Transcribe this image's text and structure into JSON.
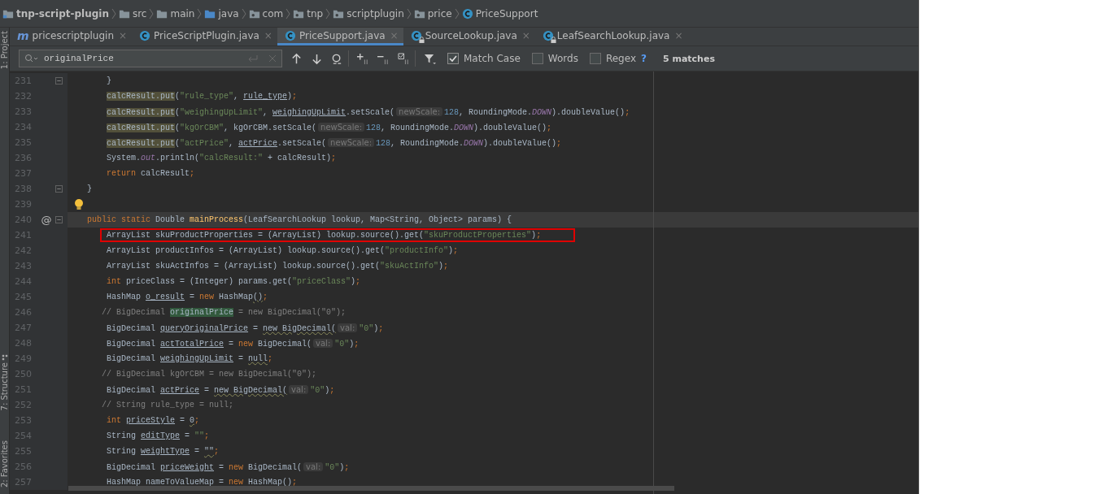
{
  "breadcrumb": [
    {
      "label": "tnp-script-plugin",
      "kind": "module",
      "bold": true
    },
    {
      "label": "src",
      "kind": "folder",
      "bold": false
    },
    {
      "label": "main",
      "kind": "folder",
      "bold": false
    },
    {
      "label": "java",
      "kind": "source",
      "bold": false
    },
    {
      "label": "com",
      "kind": "package",
      "bold": false
    },
    {
      "label": "tnp",
      "kind": "package",
      "bold": false
    },
    {
      "label": "scriptplugin",
      "kind": "package",
      "bold": false
    },
    {
      "label": "price",
      "kind": "package",
      "bold": false
    },
    {
      "label": "PriceSupport",
      "kind": "class",
      "bold": false
    }
  ],
  "side_tools": [
    "1: Project",
    "7: Structure",
    "2: Favorites"
  ],
  "tabs": [
    {
      "label": "pricescriptplugin",
      "kind": "module",
      "icon_text": "m",
      "locked": false,
      "selected": false,
      "close": "×"
    },
    {
      "label": "PriceScriptPlugin.java",
      "kind": "class",
      "locked": false,
      "selected": false,
      "close": "×"
    },
    {
      "label": "PriceSupport.java",
      "kind": "class",
      "locked": false,
      "selected": true,
      "close": "×"
    },
    {
      "label": "SourceLookup.java",
      "kind": "class",
      "locked": true,
      "selected": false,
      "close": "×"
    },
    {
      "label": "LeafSearchLookup.java",
      "kind": "class",
      "locked": true,
      "selected": false,
      "close": "×"
    }
  ],
  "search": {
    "value": "originalPrice",
    "options": [
      {
        "label": "Match Case",
        "checked": true
      },
      {
        "label": "Words",
        "checked": false
      },
      {
        "label": "Regex",
        "checked": false
      }
    ],
    "help": "?",
    "matches": "5 matches"
  },
  "lines": [
    {
      "n": "231",
      "kind": "stmt",
      "fold": true,
      "bulb": false,
      "current": false,
      "boxed": false,
      "tokens": [
        {
          "kind": "p",
          "t": "}"
        }
      ]
    },
    {
      "n": "232",
      "kind": "stmt",
      "fold": false,
      "bulb": false,
      "current": false,
      "boxed": false,
      "tokens": [
        {
          "kind": "usage",
          "t": "calcResult.put"
        },
        {
          "kind": "p",
          "t": "("
        },
        {
          "kind": "str",
          "t": "\"rule_type\""
        },
        {
          "kind": "p",
          "t": ", "
        },
        {
          "kind": "u",
          "t": "rule_type"
        },
        {
          "kind": "p",
          "t": ")"
        },
        {
          "kind": "kw",
          "t": ";"
        }
      ]
    },
    {
      "n": "233",
      "kind": "stmt",
      "fold": false,
      "bulb": false,
      "current": false,
      "boxed": false,
      "tokens": [
        {
          "kind": "usage",
          "t": "calcResult.put"
        },
        {
          "kind": "p",
          "t": "("
        },
        {
          "kind": "str",
          "t": "\"weighingUpLimit\""
        },
        {
          "kind": "p",
          "t": ", "
        },
        {
          "kind": "u",
          "t": "weighingUpLimit"
        },
        {
          "kind": "p",
          "t": ".setScale("
        },
        {
          "kind": "hint",
          "t": "newScale:"
        },
        {
          "kind": "num",
          "t": "128"
        },
        {
          "kind": "p",
          "t": ", RoundingMode."
        },
        {
          "kind": "st",
          "t": "DOWN"
        },
        {
          "kind": "p",
          "t": ").doubleValue()"
        },
        {
          "kind": "kw",
          "t": ";"
        }
      ]
    },
    {
      "n": "234",
      "kind": "stmt",
      "fold": false,
      "bulb": false,
      "current": false,
      "boxed": false,
      "tokens": [
        {
          "kind": "usage",
          "t": "calcResult.put"
        },
        {
          "kind": "p",
          "t": "("
        },
        {
          "kind": "str",
          "t": "\"kgOrCBM\""
        },
        {
          "kind": "p",
          "t": ", kgOrCBM.setScale("
        },
        {
          "kind": "hint",
          "t": "newScale:"
        },
        {
          "kind": "num",
          "t": "128"
        },
        {
          "kind": "p",
          "t": ", RoundingMode."
        },
        {
          "kind": "st",
          "t": "DOWN"
        },
        {
          "kind": "p",
          "t": ").doubleValue()"
        },
        {
          "kind": "kw",
          "t": ";"
        }
      ]
    },
    {
      "n": "235",
      "kind": "stmt",
      "fold": false,
      "bulb": false,
      "current": false,
      "boxed": false,
      "tokens": [
        {
          "kind": "usage",
          "t": "calcResult.put"
        },
        {
          "kind": "p",
          "t": "("
        },
        {
          "kind": "str",
          "t": "\"actPrice\""
        },
        {
          "kind": "p",
          "t": ", "
        },
        {
          "kind": "u",
          "t": "actPrice"
        },
        {
          "kind": "p",
          "t": ".setScale("
        },
        {
          "kind": "hint",
          "t": "newScale:"
        },
        {
          "kind": "num",
          "t": "128"
        },
        {
          "kind": "p",
          "t": ", RoundingMode."
        },
        {
          "kind": "st",
          "t": "DOWN"
        },
        {
          "kind": "p",
          "t": ").doubleValue()"
        },
        {
          "kind": "kw",
          "t": ";"
        }
      ]
    },
    {
      "n": "236",
      "kind": "stmt",
      "fold": false,
      "bulb": false,
      "current": false,
      "boxed": false,
      "tokens": [
        {
          "kind": "p",
          "t": "System."
        },
        {
          "kind": "st",
          "t": "out"
        },
        {
          "kind": "p",
          "t": ".println("
        },
        {
          "kind": "str",
          "t": "\"calcResult:\""
        },
        {
          "kind": "p",
          "t": " + calcResult)"
        },
        {
          "kind": "kw",
          "t": ";"
        }
      ]
    },
    {
      "n": "237",
      "kind": "stmt",
      "fold": false,
      "bulb": false,
      "current": false,
      "boxed": false,
      "tokens": [
        {
          "kind": "kw",
          "t": "return"
        },
        {
          "kind": "p",
          "t": " calcResult"
        },
        {
          "kind": "kw",
          "t": ";"
        }
      ]
    },
    {
      "n": "238",
      "kind": "member",
      "fold": true,
      "bulb": false,
      "current": false,
      "boxed": false,
      "tokens": [
        {
          "kind": "p",
          "t": "}"
        }
      ]
    },
    {
      "n": "239",
      "kind": "blank",
      "fold": false,
      "bulb": true,
      "current": false,
      "boxed": false
    },
    {
      "n": "240",
      "kind": "member",
      "fold": true,
      "bulb": false,
      "mark": "@",
      "current": true,
      "boxed": false,
      "tokens": [
        {
          "kind": "kw",
          "t": "public static"
        },
        {
          "kind": "p",
          "t": " Double "
        },
        {
          "kind": "decl",
          "t": "mainProcess"
        },
        {
          "kind": "p",
          "t": "(LeafSearchLookup lookup, Map<String, Object> params) {"
        }
      ]
    },
    {
      "n": "241",
      "kind": "stmt",
      "fold": false,
      "bulb": false,
      "current": false,
      "boxed": true,
      "tokens": [
        {
          "kind": "p",
          "t": "ArrayList skuProductProperties = (ArrayList) lookup.source().get("
        },
        {
          "kind": "str",
          "t": "\"skuProductProperties\""
        },
        {
          "kind": "p",
          "t": ")"
        },
        {
          "kind": "kw",
          "t": ";"
        }
      ]
    },
    {
      "n": "242",
      "kind": "stmt",
      "fold": false,
      "bulb": false,
      "current": false,
      "boxed": false,
      "tokens": [
        {
          "kind": "p",
          "t": "ArrayList productInfos = (ArrayList) lookup.source().get("
        },
        {
          "kind": "str",
          "t": "\"productInfo\""
        },
        {
          "kind": "p",
          "t": ")"
        },
        {
          "kind": "kw",
          "t": ";"
        }
      ]
    },
    {
      "n": "243",
      "kind": "stmt",
      "fold": false,
      "bulb": false,
      "current": false,
      "boxed": false,
      "tokens": [
        {
          "kind": "p",
          "t": "ArrayList skuActInfos = (ArrayList) lookup.source().get("
        },
        {
          "kind": "str",
          "t": "\"skuActInfo\""
        },
        {
          "kind": "p",
          "t": ")"
        },
        {
          "kind": "kw",
          "t": ";"
        }
      ]
    },
    {
      "n": "244",
      "kind": "stmt",
      "fold": false,
      "bulb": false,
      "current": false,
      "boxed": false,
      "tokens": [
        {
          "kind": "kw",
          "t": "int"
        },
        {
          "kind": "p",
          "t": " priceClass = (Integer) params.get("
        },
        {
          "kind": "str",
          "t": "\"priceClass\""
        },
        {
          "kind": "p",
          "t": ")"
        },
        {
          "kind": "kw",
          "t": ";"
        }
      ]
    },
    {
      "n": "245",
      "kind": "stmt",
      "fold": false,
      "bulb": false,
      "current": false,
      "boxed": false,
      "tokens": [
        {
          "kind": "p",
          "t": "HashMap "
        },
        {
          "kind": "u",
          "t": "o_result"
        },
        {
          "kind": "p",
          "t": " = "
        },
        {
          "kind": "kw",
          "t": "new"
        },
        {
          "kind": "p",
          "t": " HashMap"
        },
        {
          "kind": "w",
          "t": "()"
        },
        {
          "kind": "kw",
          "t": ";"
        }
      ]
    },
    {
      "n": "246",
      "kind": "commented",
      "fold": false,
      "bulb": false,
      "current": false,
      "boxed": false,
      "tokens": [
        {
          "kind": "cm",
          "t": "// BigDecimal "
        },
        {
          "kind": "match",
          "t": "originalPrice"
        },
        {
          "kind": "cm",
          "t": " = new BigDecimal(\"0\");"
        }
      ]
    },
    {
      "n": "247",
      "kind": "stmt",
      "fold": false,
      "bulb": false,
      "current": false,
      "boxed": false,
      "tokens": [
        {
          "kind": "p",
          "t": "BigDecimal "
        },
        {
          "kind": "u",
          "t": "queryOriginalPrice"
        },
        {
          "kind": "p",
          "t": " = "
        },
        {
          "kind": "w",
          "t": "new BigDecimal("
        },
        {
          "kind": "hint",
          "t": "val:"
        },
        {
          "kind": "str",
          "t": "\"0\""
        },
        {
          "kind": "p",
          "t": ")"
        },
        {
          "kind": "kw",
          "t": ";"
        }
      ]
    },
    {
      "n": "248",
      "kind": "stmt",
      "fold": false,
      "bulb": false,
      "current": false,
      "boxed": false,
      "tokens": [
        {
          "kind": "p",
          "t": "BigDecimal "
        },
        {
          "kind": "u",
          "t": "actTotalPrice"
        },
        {
          "kind": "p",
          "t": " = "
        },
        {
          "kind": "kw",
          "t": "new"
        },
        {
          "kind": "p",
          "t": " BigDecimal("
        },
        {
          "kind": "hint",
          "t": "val:"
        },
        {
          "kind": "str",
          "t": "\"0\""
        },
        {
          "kind": "p",
          "t": ")"
        },
        {
          "kind": "kw",
          "t": ";"
        }
      ]
    },
    {
      "n": "249",
      "kind": "stmt",
      "fold": false,
      "bulb": false,
      "current": false,
      "boxed": false,
      "tokens": [
        {
          "kind": "p",
          "t": "BigDecimal "
        },
        {
          "kind": "u",
          "t": "weighingUpLimit"
        },
        {
          "kind": "p",
          "t": " = "
        },
        {
          "kind": "w",
          "t": "null"
        },
        {
          "kind": "kw",
          "t": ";"
        }
      ]
    },
    {
      "n": "250",
      "kind": "commented",
      "fold": false,
      "bulb": false,
      "current": false,
      "boxed": false,
      "tokens": [
        {
          "kind": "cm",
          "t": "// BigDecimal kgOrCBM = new BigDecimal(\"0\");"
        }
      ]
    },
    {
      "n": "251",
      "kind": "stmt",
      "fold": false,
      "bulb": false,
      "current": false,
      "boxed": false,
      "tokens": [
        {
          "kind": "p",
          "t": "BigDecimal "
        },
        {
          "kind": "u",
          "t": "actPrice"
        },
        {
          "kind": "p",
          "t": " = "
        },
        {
          "kind": "w",
          "t": "new BigDecimal("
        },
        {
          "kind": "hint",
          "t": "val:"
        },
        {
          "kind": "str",
          "t": "\"0\""
        },
        {
          "kind": "p",
          "t": ")"
        },
        {
          "kind": "kw",
          "t": ";"
        }
      ]
    },
    {
      "n": "252",
      "kind": "commented",
      "fold": false,
      "bulb": false,
      "current": false,
      "boxed": false,
      "tokens": [
        {
          "kind": "cm",
          "t": "// String rule_type = null;"
        }
      ]
    },
    {
      "n": "253",
      "kind": "stmt",
      "fold": false,
      "bulb": false,
      "current": false,
      "boxed": false,
      "tokens": [
        {
          "kind": "kw",
          "t": "int "
        },
        {
          "kind": "u",
          "t": "priceStyle"
        },
        {
          "kind": "p",
          "t": " = "
        },
        {
          "kind": "w",
          "t": "0"
        },
        {
          "kind": "kw",
          "t": ";"
        }
      ]
    },
    {
      "n": "254",
      "kind": "stmt",
      "fold": false,
      "bulb": false,
      "current": false,
      "boxed": false,
      "tokens": [
        {
          "kind": "p",
          "t": "String "
        },
        {
          "kind": "u",
          "t": "editType"
        },
        {
          "kind": "p",
          "t": " = "
        },
        {
          "kind": "str",
          "t": "\"\""
        },
        {
          "kind": "kw",
          "t": ";"
        }
      ]
    },
    {
      "n": "255",
      "kind": "stmt",
      "fold": false,
      "bulb": false,
      "current": false,
      "boxed": false,
      "tokens": [
        {
          "kind": "p",
          "t": "String "
        },
        {
          "kind": "u",
          "t": "weightType"
        },
        {
          "kind": "p",
          "t": " = "
        },
        {
          "kind": "w",
          "t": "\"\""
        },
        {
          "kind": "kw",
          "t": ";"
        }
      ]
    },
    {
      "n": "256",
      "kind": "stmt",
      "fold": false,
      "bulb": false,
      "current": false,
      "boxed": false,
      "tokens": [
        {
          "kind": "p",
          "t": "BigDecimal "
        },
        {
          "kind": "u",
          "t": "priceWeight"
        },
        {
          "kind": "p",
          "t": " = "
        },
        {
          "kind": "kw",
          "t": "new"
        },
        {
          "kind": "p",
          "t": " BigDecimal("
        },
        {
          "kind": "hint",
          "t": "val:"
        },
        {
          "kind": "str",
          "t": "\"0\""
        },
        {
          "kind": "p",
          "t": ")"
        },
        {
          "kind": "kw",
          "t": ";"
        }
      ]
    },
    {
      "n": "257",
      "kind": "stmt",
      "fold": false,
      "bulb": false,
      "current": false,
      "boxed": false,
      "tokens": [
        {
          "kind": "p",
          "t": "HashMap nameToValueMap = "
        },
        {
          "kind": "kw",
          "t": "new"
        },
        {
          "kind": "p",
          "t": " HashMap"
        },
        {
          "kind": "w",
          "t": "()"
        },
        {
          "kind": "kw",
          "t": ";"
        }
      ]
    }
  ]
}
